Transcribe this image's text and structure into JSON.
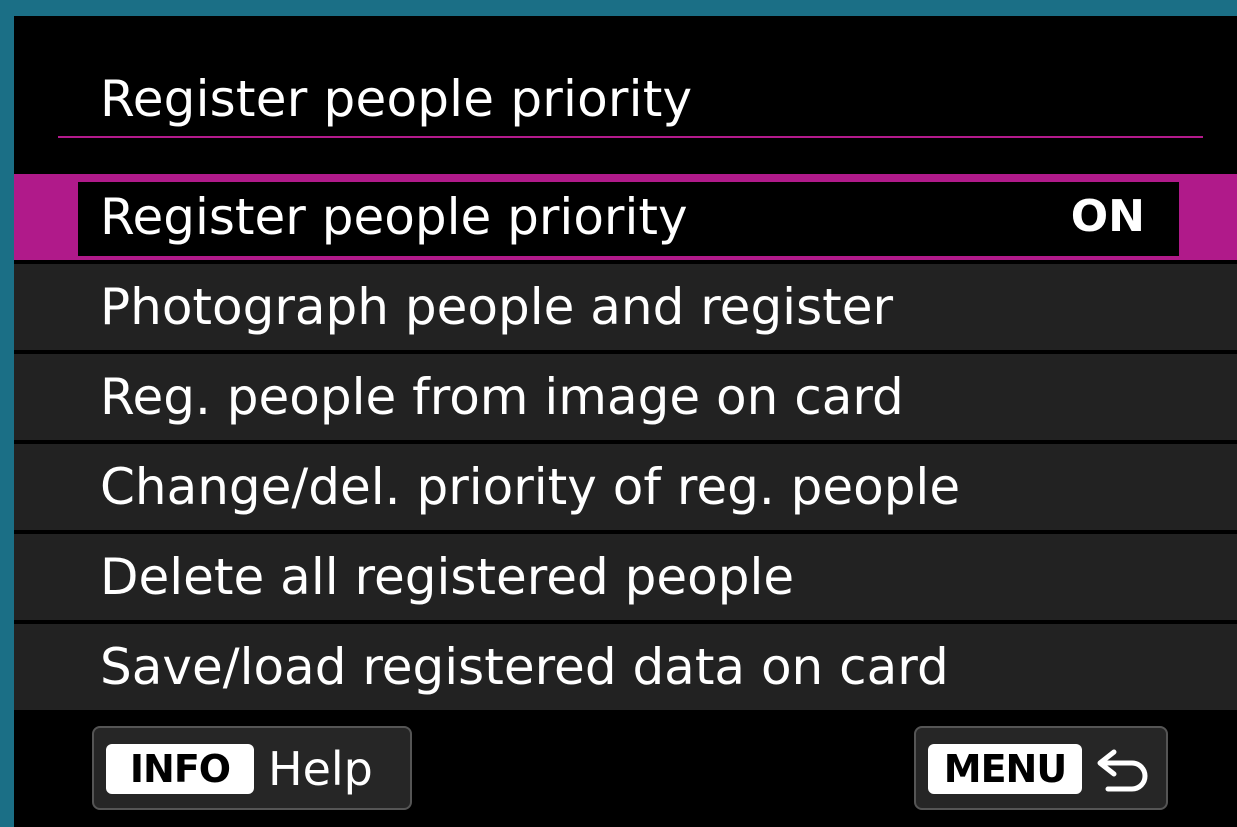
{
  "header": {
    "title": "Register people priority"
  },
  "menu": {
    "items": [
      {
        "label": "Register people priority",
        "value": "ON",
        "selected": true
      },
      {
        "label": "Photograph people and register"
      },
      {
        "label": "Reg. people from image on card"
      },
      {
        "label": "Change/del. priority of reg. people"
      },
      {
        "label": "Delete all registered people"
      },
      {
        "label": "Save/load registered data on card"
      }
    ]
  },
  "footer": {
    "info_key": "INFO",
    "help_label": "Help",
    "menu_key": "MENU",
    "back_icon": "return-arrow-icon"
  },
  "colors": {
    "accent": "#b01a8a",
    "background": "#000000",
    "row": "#222222",
    "frame": "#1b6f86"
  }
}
